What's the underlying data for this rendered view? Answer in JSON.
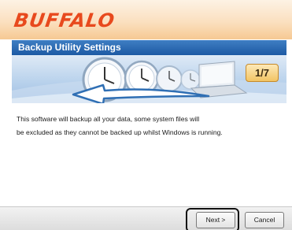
{
  "brand": {
    "logo_text": "BUFFALO",
    "logo_color": "#e8491d"
  },
  "dialog": {
    "title": "Backup Utility Settings",
    "title_bg": "#1d5aa4"
  },
  "banner": {
    "step": "1/7",
    "illustration": "clocks-arrow-laptop"
  },
  "content": {
    "line1": "This software will backup all your data, some system files will",
    "line2": "be excluded as they cannot be backed up whilst Windows is running."
  },
  "buttons": {
    "next_label": "Next >",
    "cancel_label": "Cancel"
  },
  "annotation": {
    "highlighted_control": "next-button"
  }
}
